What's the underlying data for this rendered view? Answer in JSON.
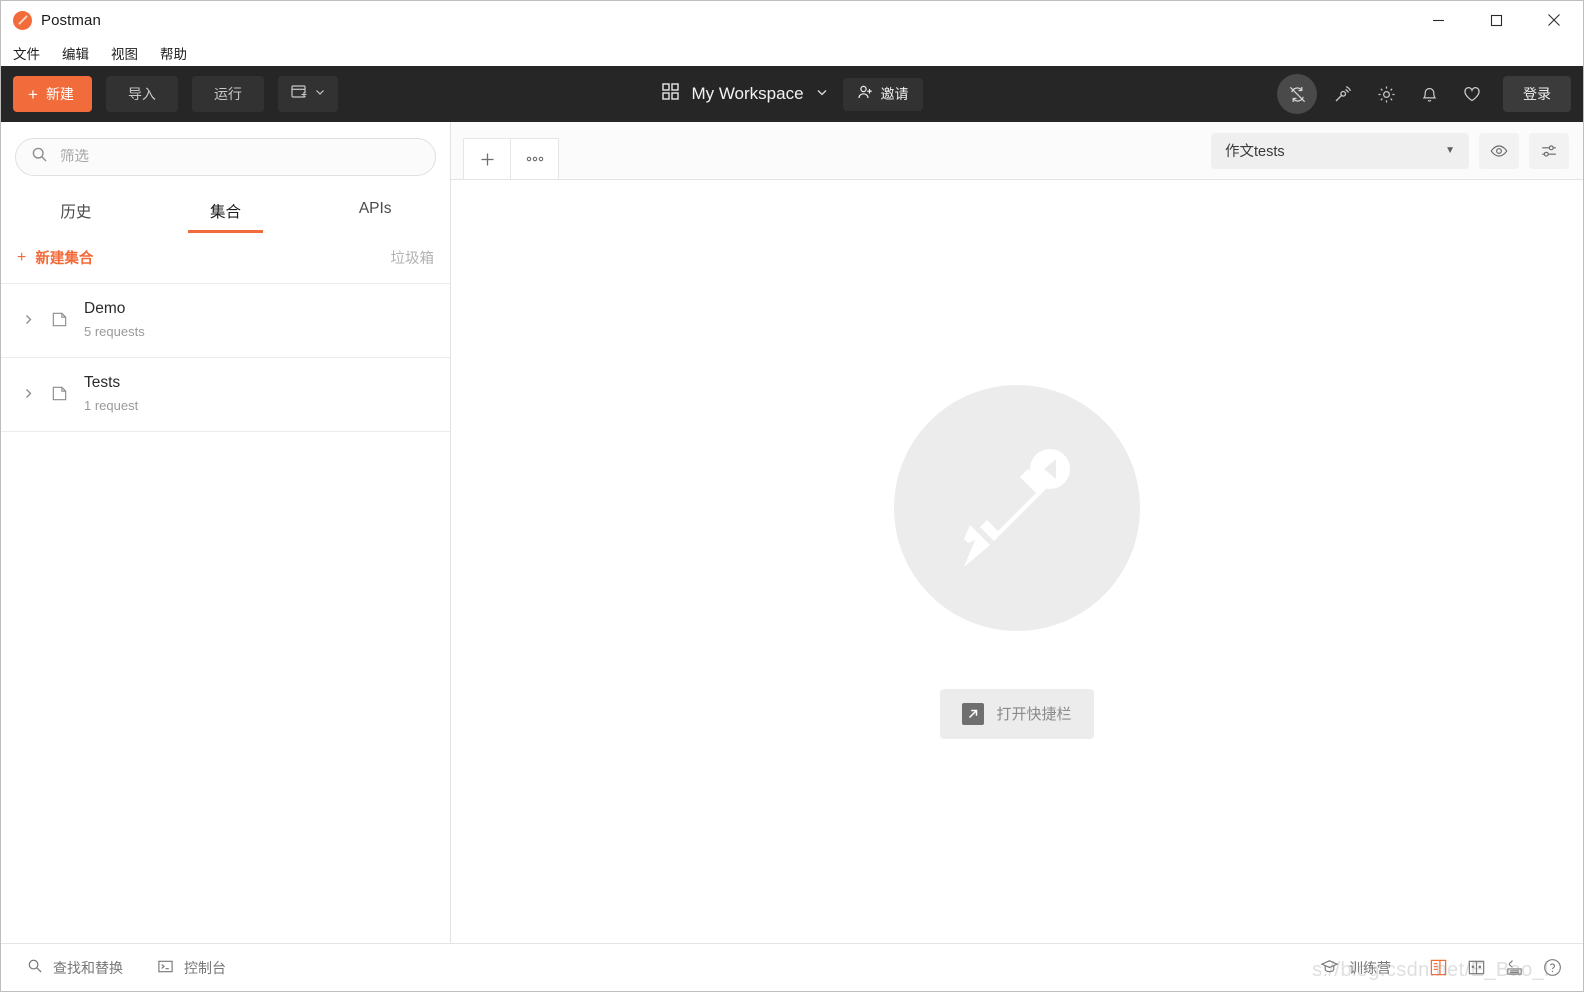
{
  "window": {
    "app_title": "Postman",
    "logo_icon": "postman-logo-icon",
    "controls": {
      "minimize": "minimize-icon",
      "maximize": "maximize-icon",
      "close": "close-icon"
    }
  },
  "menubar": {
    "items": [
      {
        "label": "文件"
      },
      {
        "label": "编辑"
      },
      {
        "label": "视图"
      },
      {
        "label": "帮助"
      }
    ]
  },
  "header": {
    "new_button": {
      "label": "新建",
      "icon": "plus-icon",
      "color": "#f26b3a"
    },
    "import_button": {
      "label": "导入"
    },
    "runner_button": {
      "label": "运行"
    },
    "new_window_button": {
      "icon": "new-window-icon",
      "caret": "chevron-down-icon"
    },
    "workspace": {
      "grid_icon": "grid-icon",
      "name": "My Workspace",
      "caret": "chevron-down-icon"
    },
    "invite_button": {
      "label": "邀请",
      "icon": "person-add-icon"
    },
    "icons": [
      {
        "name": "sync-off-icon",
        "active": true
      },
      {
        "name": "satellite-icon",
        "active": false
      },
      {
        "name": "gear-icon",
        "active": false
      },
      {
        "name": "bell-icon",
        "active": false
      },
      {
        "name": "heart-icon",
        "active": false
      }
    ],
    "login_button": {
      "label": "登录"
    },
    "background": "#262626"
  },
  "sidebar": {
    "search": {
      "placeholder": "筛选",
      "value": "",
      "icon": "search-icon"
    },
    "tabs": [
      {
        "label": "历史",
        "active": false
      },
      {
        "label": "集合",
        "active": true
      },
      {
        "label": "APIs",
        "active": false
      }
    ],
    "new_collection": {
      "label": "新建集合",
      "icon": "plus-icon"
    },
    "trash": {
      "label": "垃圾箱"
    },
    "collections": [
      {
        "name": "Demo",
        "meta": "5 requests",
        "chevron": "chevron-right-icon",
        "folder": "folder-icon"
      },
      {
        "name": "Tests",
        "meta": "1 request",
        "chevron": "chevron-right-icon",
        "folder": "folder-icon"
      }
    ]
  },
  "main": {
    "tabbar": {
      "new_tab": {
        "icon": "plus-icon"
      },
      "more_options": {
        "icon": "ellipsis-icon"
      }
    },
    "environment": {
      "selected": "作文tests",
      "caret": "caret-down-icon",
      "eye_button": {
        "icon": "eye-icon"
      },
      "settings_button": {
        "icon": "sliders-icon"
      }
    },
    "empty_state": {
      "logo": "postman-pen-watermark-icon",
      "launch_button": {
        "label": "打开快捷栏",
        "icon": "external-link-icon"
      }
    }
  },
  "statusbar": {
    "left_items": [
      {
        "label": "查找和替换",
        "icon": "search-icon"
      },
      {
        "label": "控制台",
        "icon": "terminal-icon"
      }
    ],
    "bootcamp": {
      "label": "训练营",
      "icon": "graduation-cap-icon"
    },
    "right_icons": [
      {
        "name": "single-pane-layout-icon",
        "accent": true
      },
      {
        "name": "two-pane-layout-icon",
        "accent": false
      },
      {
        "name": "keyboard-shortcuts-icon",
        "accent": false
      },
      {
        "name": "help-icon",
        "accent": false
      }
    ],
    "watermark": "s://blog.csdn.net/E_Bao_l"
  }
}
